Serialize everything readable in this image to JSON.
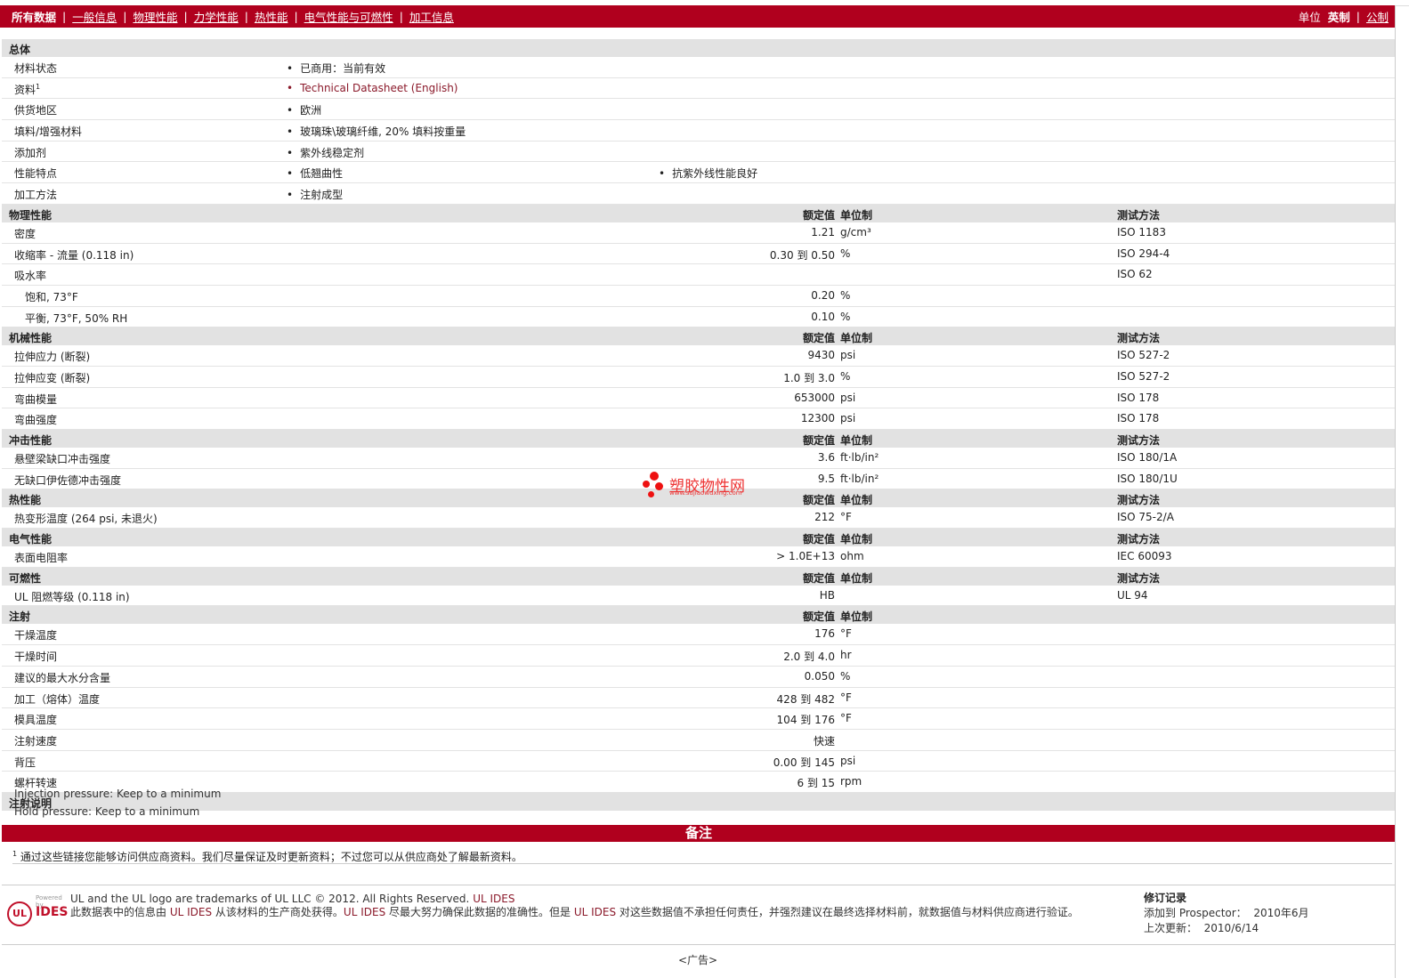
{
  "nav": {
    "tabs": [
      "所有数据",
      "一般信息",
      "物理性能",
      "力学性能",
      "热性能",
      "电气性能与可燃性",
      "加工信息"
    ],
    "units_label": "单位",
    "unit_english": "英制",
    "unit_metric": "公制"
  },
  "general": {
    "title": "总体",
    "rows": [
      {
        "name": "材料状态",
        "v1": "已商用：当前有效"
      },
      {
        "name": "资料",
        "sup": "1",
        "v1": "Technical Datasheet (English)"
      },
      {
        "name": "供货地区",
        "v1": "欧洲"
      },
      {
        "name": "填料/增强材料",
        "v1": "玻璃珠\\玻璃纤维, 20% 填料按重量"
      },
      {
        "name": "添加剂",
        "v1": "紫外线稳定剂"
      },
      {
        "name": "性能特点",
        "v1": "低翘曲性",
        "v2": "抗紫外线性能良好"
      },
      {
        "name": "加工方法",
        "v1": "注射成型"
      }
    ]
  },
  "headers": {
    "value": "额定值",
    "unit": "单位制",
    "test": "测试方法"
  },
  "physical": {
    "title": "物理性能",
    "rows": [
      {
        "name": "密度",
        "value": "1.21",
        "unit": "g/cm³",
        "test": "ISO 1183"
      },
      {
        "name": "收缩率  - 流量  (0.118 in)",
        "value": "0.30 到  0.50",
        "unit": "%",
        "test": "ISO 294-4"
      },
      {
        "name": "吸水率",
        "value": "",
        "unit": "",
        "test": "ISO 62"
      },
      {
        "name": "饱和, 73°F",
        "value": "0.20",
        "unit": "%",
        "test": ""
      },
      {
        "name": "平衡, 73°F, 50% RH",
        "value": "0.10",
        "unit": "%",
        "test": ""
      }
    ]
  },
  "mechanical": {
    "title": "机械性能",
    "rows": [
      {
        "name": "拉伸应力  (断裂)",
        "value": "9430",
        "unit": "psi",
        "test": "ISO 527-2"
      },
      {
        "name": "拉伸应变  (断裂)",
        "value": "1.0 到  3.0",
        "unit": "%",
        "test": "ISO 527-2"
      },
      {
        "name": "弯曲模量",
        "value": "653000",
        "unit": "psi",
        "test": "ISO 178"
      },
      {
        "name": "弯曲强度",
        "value": "12300",
        "unit": "psi",
        "test": "ISO 178"
      }
    ]
  },
  "impact": {
    "title": "冲击性能",
    "rows": [
      {
        "name": "悬壁梁缺口冲击强度",
        "value": "3.6",
        "unit": "ft·lb/in²",
        "test": "ISO 180/1A"
      },
      {
        "name": "无缺口伊佐德冲击强度",
        "value": "9.5",
        "unit": "ft·lb/in²",
        "test": "ISO 180/1U"
      }
    ]
  },
  "thermal": {
    "title": "热性能",
    "rows": [
      {
        "name": "热变形温度  (264 psi, 未退火)",
        "value": "212",
        "unit": "°F",
        "test": "ISO 75-2/A"
      }
    ]
  },
  "electrical": {
    "title": "电气性能",
    "rows": [
      {
        "name": "表面电阻率",
        "value": "> 1.0E+13",
        "unit": "ohm",
        "test": "IEC 60093"
      }
    ]
  },
  "flammability": {
    "title": "可燃性",
    "rows": [
      {
        "name": "UL 阻燃等级  (0.118 in)",
        "value": "HB",
        "unit": "",
        "test": "UL 94"
      }
    ]
  },
  "injection": {
    "title": "注射",
    "rows": [
      {
        "name": "干燥温度",
        "value": "176",
        "unit": "°F"
      },
      {
        "name": "干燥时间",
        "value": "2.0 到  4.0",
        "unit": "hr"
      },
      {
        "name": "建议的最大水分含量",
        "value": "0.050",
        "unit": "%"
      },
      {
        "name": "加工（熔体）温度",
        "value": "428 到  482",
        "unit": "°F"
      },
      {
        "name": "模具温度",
        "value": "104 到  176",
        "unit": "°F"
      },
      {
        "name": "注射速度",
        "value": "快速",
        "unit": ""
      },
      {
        "name": "背压",
        "value": "0.00 到  145",
        "unit": "psi"
      },
      {
        "name": "螺杆转速",
        "value": "6 到  15",
        "unit": "rpm"
      }
    ]
  },
  "injection_notes": {
    "title": "注射说明",
    "lines": [
      "Injection pressure: Keep to a minimum",
      "Hold pressure: Keep to a minimum"
    ]
  },
  "remarks": {
    "title": "备注",
    "sup": "1",
    "text": "通过这些链接您能够访问供应商资料。我们尽量保证及时更新资料；不过您可以从供应商处了解最新资料。"
  },
  "watermark": {
    "cn": "塑胶物性网",
    "url": "www.sujiaowuxing.com"
  },
  "footer": {
    "logo_powered": "Powered by",
    "logo_ul": "UL",
    "logo_ides": "IDES",
    "line1": "UL and the UL logo are trademarks of UL LLC © 2012. All Rights Reserved.",
    "line1_link": "UL IDES",
    "line2a": "此数据表中的信息由 ",
    "line2_link1": "UL IDES",
    "line2b": " 从该材料的生产商处获得。",
    "line2_link2": "UL IDES",
    "line2c": " 尽最大努力确保此数据的准确性。但是 ",
    "line2_link3": "UL IDES",
    "line2d": " 对这些数据值不承担任何责任，并强烈建议在最终选择材料前，就数据值与材料供应商进行验证。",
    "rev_title": "修订记录",
    "rev_added_label": "添加到  Prospector：",
    "rev_added": "2010年6月",
    "rev_updated_label": "上次更新：",
    "rev_updated": "2010/6/14"
  },
  "ad": "<广告>"
}
